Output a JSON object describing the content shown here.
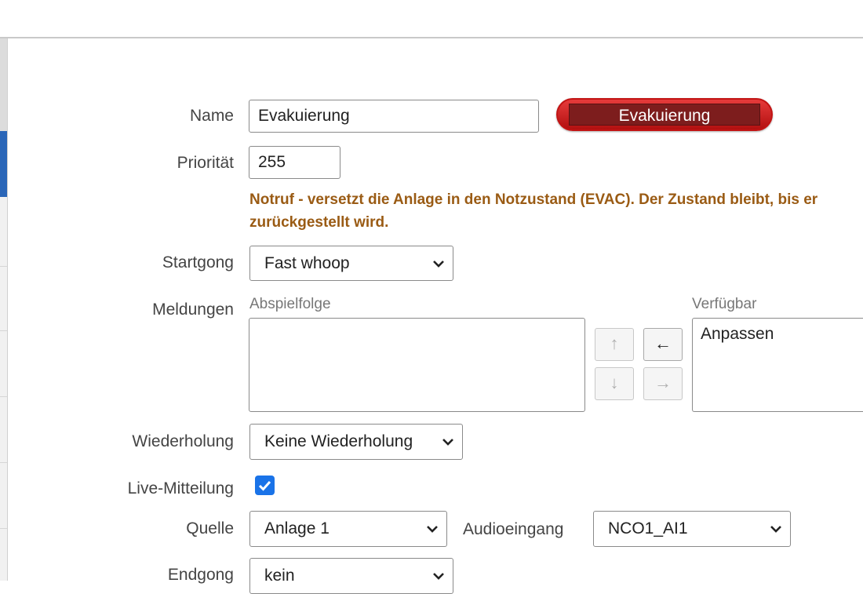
{
  "form": {
    "name": {
      "label": "Name",
      "value": "Evakuierung"
    },
    "preview_button": {
      "label": "Evakuierung",
      "color": "#c21414"
    },
    "priority": {
      "label": "Priorität",
      "value": "255"
    },
    "note": {
      "line1": "Notruf - versetzt die Anlage in den Notzustand (EVAC). Der Zustand bleibt, bis er",
      "line2": "zurückgestellt wird.",
      "color": "#9a5b14"
    },
    "startgong": {
      "label": "Startgong",
      "value": "Fast whoop"
    },
    "messages": {
      "label": "Meldungen",
      "playlist_label": "Abspielfolge",
      "playlist_items": [],
      "available_label": "Verfügbar",
      "available_items": [
        "Anpassen"
      ],
      "move_up": "↑",
      "move_down": "↓",
      "move_left": "←",
      "move_right": "→"
    },
    "repeat": {
      "label": "Wiederholung",
      "value": "Keine Wiederholung"
    },
    "live": {
      "label": "Live-Mitteilung",
      "checked": true,
      "accent": "#1a73e8"
    },
    "source": {
      "label": "Quelle",
      "value": "Anlage 1"
    },
    "audio_input": {
      "label": "Audioeingang",
      "value": "NCO1_AI1"
    },
    "endgong": {
      "label": "Endgong",
      "value": "kein"
    }
  }
}
